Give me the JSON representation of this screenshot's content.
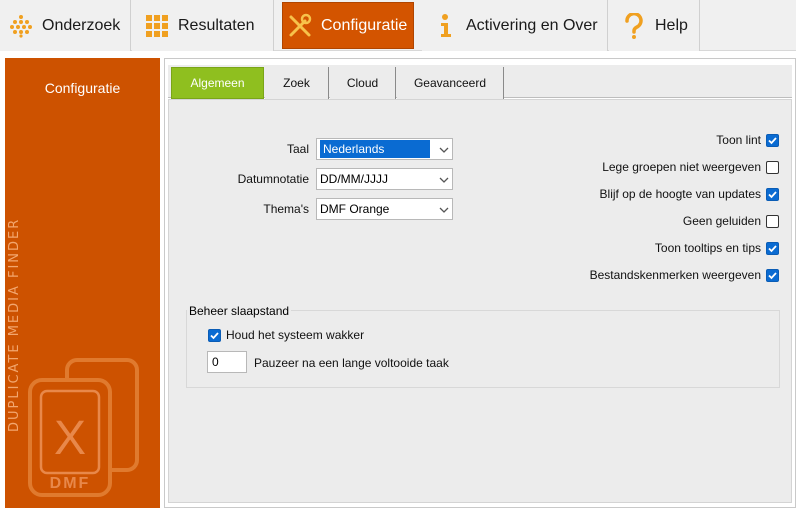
{
  "toolbar": {
    "items": [
      {
        "label": "Onderzoek",
        "icon": "dots-grid-icon"
      },
      {
        "label": "Resultaten",
        "icon": "grid-icon"
      },
      {
        "label": "Configuratie",
        "icon": "tools-icon",
        "active": true
      },
      {
        "label": "Activering en Over",
        "icon": "info-icon"
      },
      {
        "label": "Help",
        "icon": "question-icon"
      }
    ]
  },
  "sidebar": {
    "title": "Configuratie",
    "brand": "DUPLICATE MEDIA FINDER",
    "logo_text": "DMF",
    "logo_letter": "X"
  },
  "tabs": [
    {
      "label": "Algemeen",
      "active": true
    },
    {
      "label": "Zoek"
    },
    {
      "label": "Cloud"
    },
    {
      "label": "Geavanceerd"
    }
  ],
  "general": {
    "language": {
      "label": "Taal",
      "value": "Nederlands"
    },
    "date_format": {
      "label": "Datumnotatie",
      "value": "DD/MM/JJJJ"
    },
    "theme": {
      "label": "Thema's",
      "value": "DMF Orange"
    },
    "options": [
      {
        "label": "Toon lint",
        "checked": true
      },
      {
        "label": "Lege groepen niet weergeven",
        "checked": false
      },
      {
        "label": "Blijf op de hoogte van updates",
        "checked": true
      },
      {
        "label": "Geen geluiden",
        "checked": false
      },
      {
        "label": "Toon tooltips en tips",
        "checked": true
      },
      {
        "label": "Bestandskenmerken weergeven",
        "checked": true
      }
    ],
    "sleep": {
      "title": "Beheer slaapstand",
      "keep_awake": {
        "label": "Houd het systeem wakker",
        "checked": true
      },
      "pause_value": "0",
      "pause_label": "Pauzeer na een lange voltooide taak"
    }
  },
  "colors": {
    "accent_orange": "#cd5200",
    "tab_active_green": "#8fbf1f",
    "check_blue": "#0a6bd2"
  }
}
